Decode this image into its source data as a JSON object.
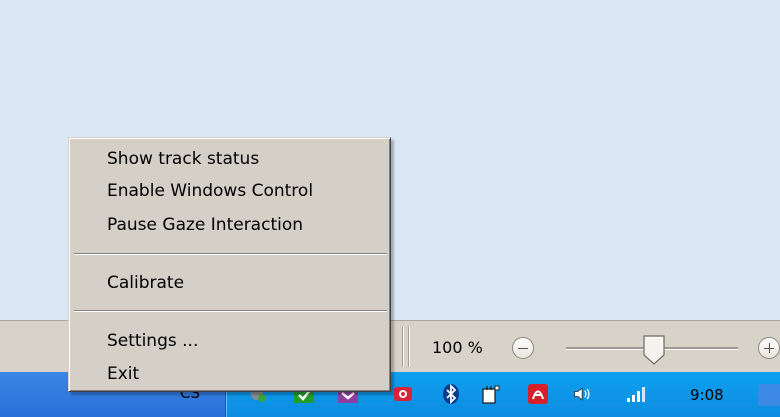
{
  "context_menu": {
    "items": [
      {
        "label": "Show track status"
      },
      {
        "label": "Enable Windows Control"
      },
      {
        "label": "Pause Gaze Interaction"
      },
      {
        "label": "Calibrate"
      },
      {
        "label": "Settings ..."
      },
      {
        "label": "Exit"
      }
    ]
  },
  "statusbar": {
    "zoom_level": "100 %",
    "zoom_slider_percent": 100
  },
  "taskbar": {
    "task_label": "CS",
    "clock": "9:08",
    "tray_icons": [
      "network-icon",
      "security-check-icon",
      "visual-studio-icon",
      "gaze-tracker-icon",
      "bluetooth-icon",
      "power-plug-icon",
      "adobe-icon",
      "speaker-icon",
      "signal-strength-icon"
    ]
  }
}
